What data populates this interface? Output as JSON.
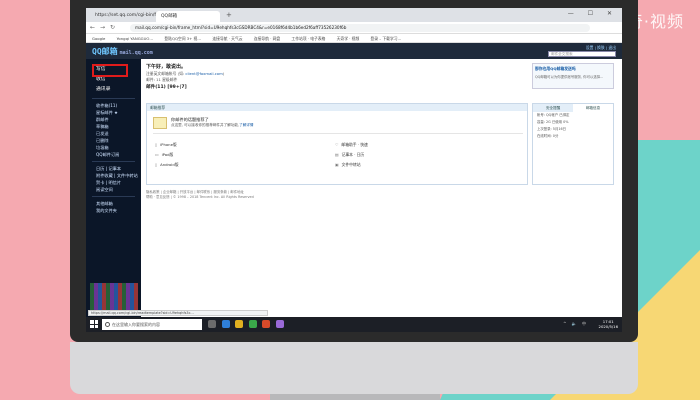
{
  "watermark": "天奇·视频",
  "browser": {
    "tabs": [
      {
        "label": "https://set.qq.com/cgi-bin/frame_..."
      },
      {
        "label": "QQ邮箱"
      }
    ],
    "new_tab": "+",
    "window_controls": "— ☐ ✕",
    "url": "mail.qq.com/cgi-bin/frame_html?sid=U9ehqhfs3cGSDRBC4&r=e0168f6d4b1b6ed2f6aff73526230f6b",
    "bookmarks": [
      "Google",
      "Yongqi YANGGUO…",
      "登陆QQ空间 3+ 视…",
      "连接导航 · 天气云",
      "连接导航 · 网盘",
      "工作站项 · 电子表格",
      "天奇学 · 视频",
      "登录 – 下载学习…"
    ]
  },
  "qq": {
    "logo": "QQ邮箱",
    "logo_sub": "mail.qq.com",
    "header_links": "设置 | 换肤 | 退出",
    "search_placeholder": "邮件全文搜索"
  },
  "sidebar": {
    "primary": [
      "写信",
      "收信",
      "通讯录"
    ],
    "items": [
      "收件箱(11)",
      "星标邮件 ★",
      "群邮件",
      "草稿箱",
      "已发送",
      "已删除",
      "垃圾箱",
      "QQ邮件订阅"
    ],
    "items2": [
      "日历 | 记事本",
      "附件收藏 | 文件中转站",
      "贺卡 | 明信片",
      "阅读空间"
    ],
    "items3": [
      "其他邮箱",
      "我的文件夹"
    ]
  },
  "content": {
    "greeting": "下午好，敢说出。",
    "email_prefix": "注册英文邮箱帐号 (如: ",
    "email_value": "client@foxmail.com",
    "email_suffix": ")",
    "score": "邮件: 11 星级邮件",
    "mail_count": "邮件(11) [99+|7]",
    "ad_title": "那你也用QQ邮箱发送吗",
    "ad_desc": "QQ邮箱可以为你提供帐号服务, 你可以选择...",
    "panel_title": "邮箱推荐",
    "notice_title": "你邮件的话题推荐了",
    "notice_desc": "点这里, 可以接收你的推荐邮件并了解功能,",
    "notice_link": "了解详情",
    "apps_left": [
      "iPhone版",
      "iPad版",
      "Android版"
    ],
    "apps_right": [
      "邮箱助手 · 快速",
      "记事本 · 日历",
      "文件中转站"
    ],
    "right_tabs": [
      "安全提醒",
      "邮箱信息"
    ],
    "right_rows": [
      "帐号: QQ帐户 已绑定",
      "容量: 2G 已使用 0%",
      "上次登录: 5月16日",
      "在线时间: 0分"
    ],
    "footer1": "隐私政策 | 企业邮箱 | 开放平台 | 邮件联系 | 服务条款 | 邮件地址",
    "footer2": "帮助 · 意见反馈 | © 1998 – 2018 Tencent Inc. All Rights Reserved"
  },
  "status_url": "https://mail.qq.com/cgi-bin/readtemplate?sid=U9ehqhfs3c…",
  "taskbar": {
    "search": "在这里输入你要搜索的内容",
    "time": "17:01",
    "date": "2020/5/16",
    "tray": "^ 🔈 中"
  }
}
